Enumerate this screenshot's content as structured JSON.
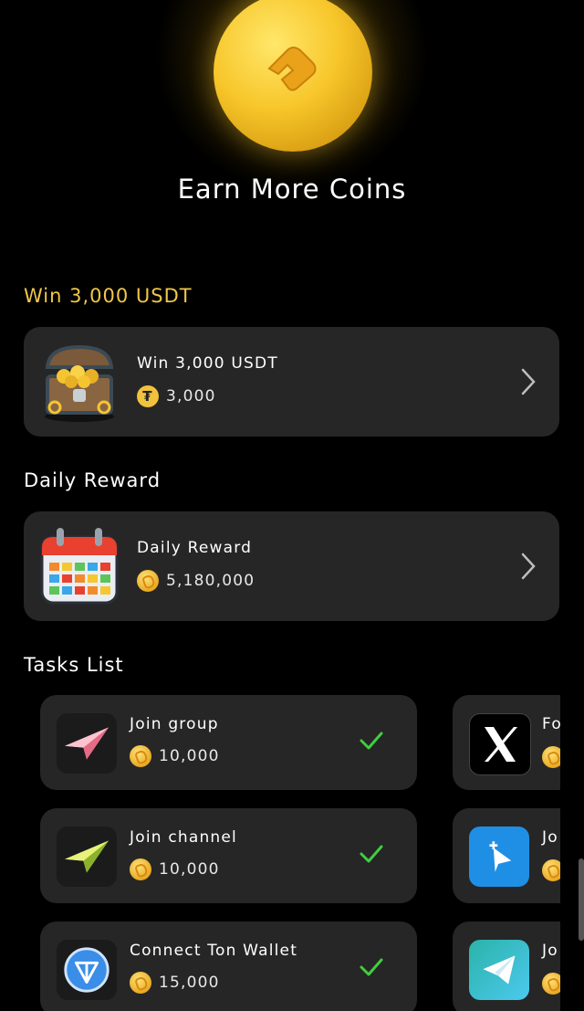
{
  "header": {
    "title": "Earn More Coins"
  },
  "sections": {
    "win": {
      "title": "Win 3,000 USDT",
      "card": {
        "name": "Win 3,000 USDT",
        "reward": "3,000",
        "icon": "treasure-chest-icon",
        "reward_icon": "tether-icon"
      }
    },
    "daily": {
      "title": "Daily Reward",
      "card": {
        "name": "Daily Reward",
        "reward": "5,180,000",
        "icon": "calendar-icon",
        "reward_icon": "coin-icon"
      }
    },
    "tasks": {
      "title": "Tasks List",
      "items": [
        {
          "name": "Join group",
          "reward": "10,000",
          "icon": "paper-plane-pink-icon",
          "done": true
        },
        {
          "name": "Join channel",
          "reward": "10,000",
          "icon": "paper-plane-yellow-icon",
          "done": true
        },
        {
          "name": "Connect Ton Wallet",
          "reward": "15,000",
          "icon": "ton-wallet-icon",
          "done": true
        }
      ],
      "side_items": [
        {
          "name": "Fo",
          "icon": "x-logo-icon"
        },
        {
          "name": "Jo",
          "icon": "bot-app-icon"
        },
        {
          "name": "Jo",
          "icon": "telegram-app-icon"
        }
      ]
    }
  },
  "colors": {
    "accent_gold": "#f0c64a",
    "card_bg": "#262626",
    "check_green": "#3fcf3f",
    "background": "#000000"
  }
}
